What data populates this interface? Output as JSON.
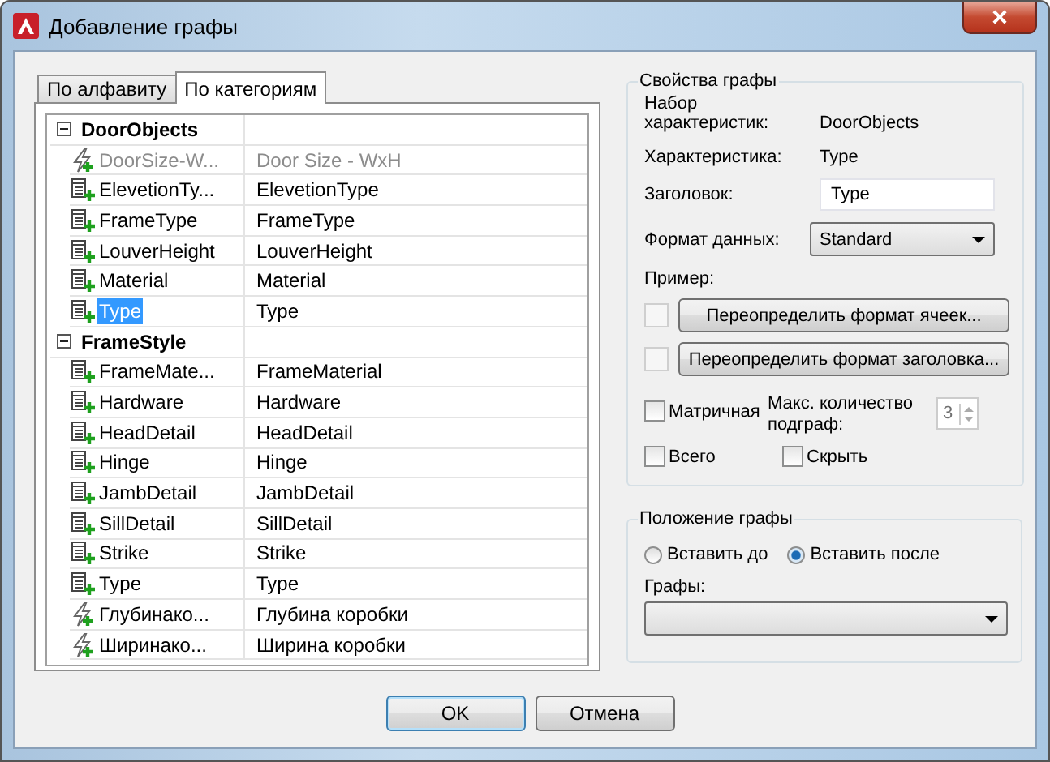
{
  "window": {
    "title": "Добавление графы"
  },
  "tabs": [
    {
      "label": "По алфавиту",
      "selected": false
    },
    {
      "label": "По категориям",
      "selected": true
    }
  ],
  "tree": [
    {
      "name": "DoorObjects",
      "expanded": true,
      "children": [
        {
          "kind": "auto",
          "name": "DoorSize-W...",
          "value": "Door Size - WxH",
          "disabled": true,
          "selected": false
        },
        {
          "kind": "manual",
          "name": "ElevetionTy...",
          "value": "ElevetionType",
          "disabled": false,
          "selected": false
        },
        {
          "kind": "manual",
          "name": "FrameType",
          "value": "FrameType",
          "disabled": false,
          "selected": false
        },
        {
          "kind": "manual",
          "name": "LouverHeight",
          "value": "LouverHeight",
          "disabled": false,
          "selected": false
        },
        {
          "kind": "manual",
          "name": "Material",
          "value": "Material",
          "disabled": false,
          "selected": false
        },
        {
          "kind": "manual",
          "name": "Type",
          "value": "Type",
          "disabled": false,
          "selected": true
        }
      ]
    },
    {
      "name": "FrameStyle",
      "expanded": true,
      "children": [
        {
          "kind": "manual",
          "name": "FrameMate...",
          "value": "FrameMaterial",
          "disabled": false,
          "selected": false
        },
        {
          "kind": "manual",
          "name": "Hardware",
          "value": "Hardware",
          "disabled": false,
          "selected": false
        },
        {
          "kind": "manual",
          "name": "HeadDetail",
          "value": "HeadDetail",
          "disabled": false,
          "selected": false
        },
        {
          "kind": "manual",
          "name": "Hinge",
          "value": "Hinge",
          "disabled": false,
          "selected": false
        },
        {
          "kind": "manual",
          "name": "JambDetail",
          "value": "JambDetail",
          "disabled": false,
          "selected": false
        },
        {
          "kind": "manual",
          "name": "SillDetail",
          "value": "SillDetail",
          "disabled": false,
          "selected": false
        },
        {
          "kind": "manual",
          "name": "Strike",
          "value": "Strike",
          "disabled": false,
          "selected": false
        },
        {
          "kind": "manual",
          "name": "Type",
          "value": "Type",
          "disabled": false,
          "selected": false
        },
        {
          "kind": "auto",
          "name": "Глубинако...",
          "value": "Глубина коробки",
          "disabled": false,
          "selected": false
        },
        {
          "kind": "auto",
          "name": "Ширинако...",
          "value": "Ширина коробки",
          "disabled": false,
          "selected": false
        }
      ]
    }
  ],
  "properties": {
    "title": "Свойства графы",
    "info": [
      {
        "label": "Набор характеристик:",
        "value": "DoorObjects"
      },
      {
        "label": "Характеристика:",
        "value": "Type"
      }
    ],
    "header": {
      "label": "Заголовок:",
      "value": "Type"
    },
    "format": {
      "label": "Формат данных:",
      "value": "Standard"
    },
    "example": "Пример:",
    "overrides": [
      {
        "checked": false,
        "button": "Переопределить формат ячеек..."
      },
      {
        "checked": false,
        "button": "Переопределить формат заголовка..."
      }
    ],
    "matrix": {
      "label": "Матричная",
      "checked": false
    },
    "max_count": {
      "label": "Макс. количество подграф:",
      "value": "3",
      "disabled": true
    },
    "total": {
      "label": "Всего",
      "checked": false
    },
    "hide": {
      "label": "Скрыть",
      "checked": false
    }
  },
  "position": {
    "title": "Положение графы",
    "options": [
      {
        "label": "Вставить до",
        "selected": false
      },
      {
        "label": "Вставить после",
        "selected": true
      }
    ],
    "columns_label": "Графы:"
  },
  "buttons": [
    "OK",
    "Отмена"
  ]
}
